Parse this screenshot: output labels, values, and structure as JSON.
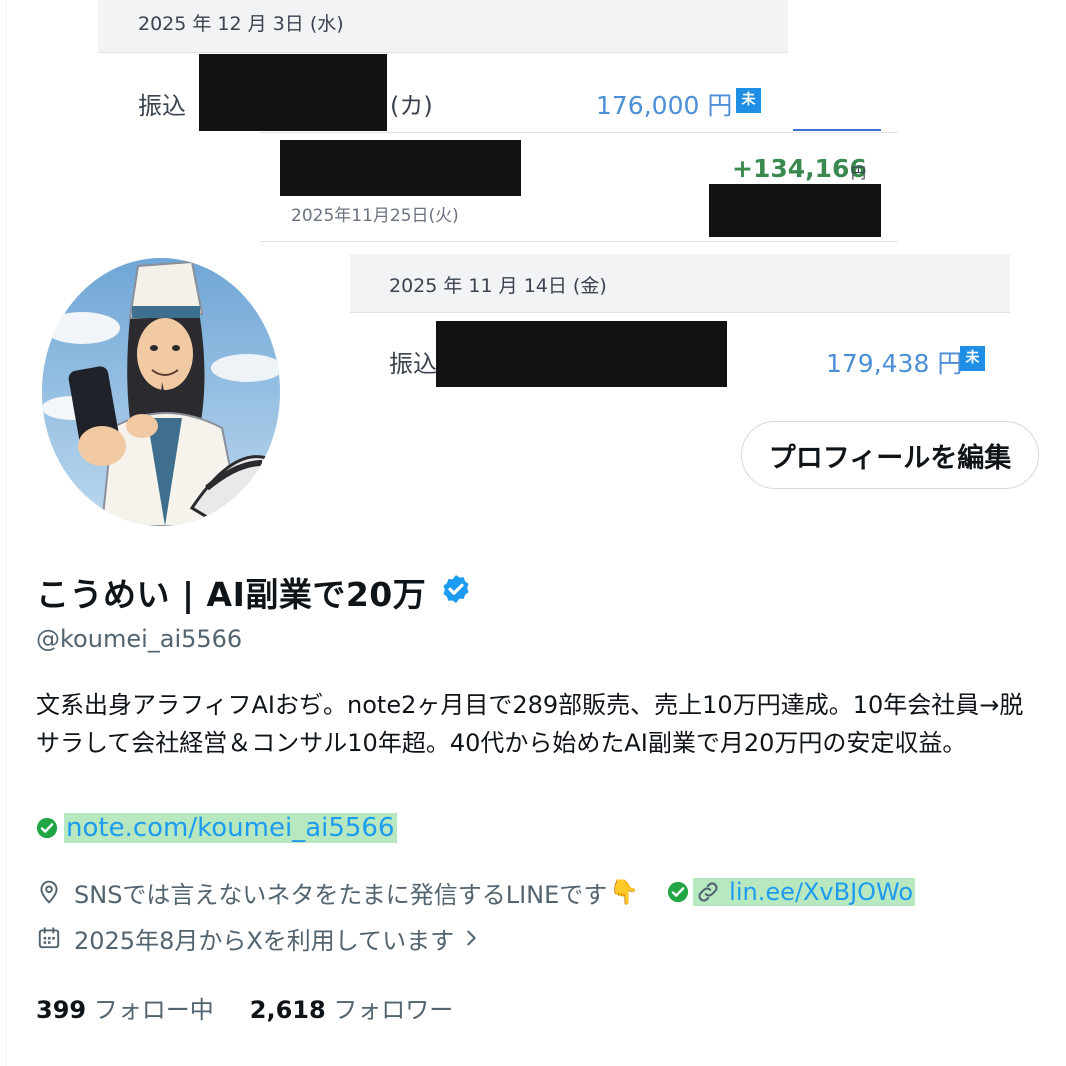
{
  "banner": {
    "date1": "2025 年 12 月 3日 (水)",
    "row1_label": "振込",
    "row1_suffix": "(カ)",
    "row1_amount": "176,000 円",
    "badge": "未",
    "mid_amount": "+134,166",
    "mid_yen": "円",
    "mid_date": "2025年11月25日(火)",
    "date2": "2025 年 11 月 14日 (金)",
    "row2_label": "振込",
    "row2_amount": "179,438 円"
  },
  "profile": {
    "edit_button": "プロフィールを編集",
    "display_name": "こうめい | AI副業で20万",
    "handle": "@koumei_ai5566",
    "bio": "文系出身アラフィフAIおぢ。note2ヶ月目で289部販売、売上10万円達成。10年会社員→脱サラして会社経営＆コンサル10年超。40代から始めたAI副業で月20万円の安定収益。",
    "bio_link": "note.com/koumei_ai5566",
    "location": "SNSでは言えないネタをたまに発信するLINEです",
    "location_emoji": "👇",
    "website": "lin.ee/XvBJOWo",
    "joined": "2025年8月からXを利用しています",
    "following_count": "399",
    "following_label": "フォロー中",
    "followers_count": "2,618",
    "followers_label": "フォロワー"
  },
  "colors": {
    "verified_blue": "#1d9bf0",
    "link_blue": "#1d9bf0",
    "link_highlight": "#b8e8bf",
    "check_green": "#21a645",
    "income_green": "#3a8a4f",
    "amount_blue": "#4d8fd6"
  },
  "icons": [
    "verified-badge-icon",
    "green-check-icon",
    "location-pin-icon",
    "link-icon",
    "calendar-icon",
    "chevron-right-icon"
  ]
}
